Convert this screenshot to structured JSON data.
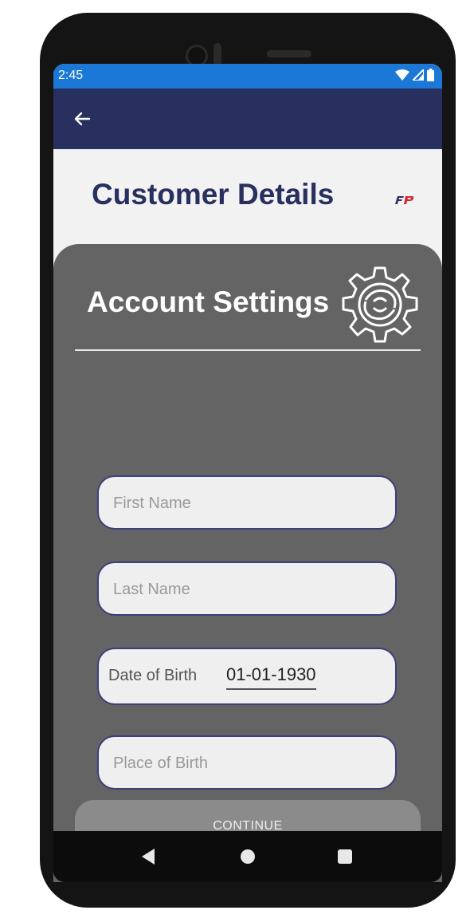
{
  "status_bar": {
    "time": "2:45",
    "icons": [
      "wifi-icon",
      "signal-icon",
      "battery-icon"
    ]
  },
  "app_bar": {
    "back_icon": "arrow-left-icon",
    "color": "#27305e"
  },
  "header": {
    "title": "Customer Details",
    "logo_text": "FP"
  },
  "panel": {
    "title": "Account Settings",
    "icon": "gear-icon",
    "fields": {
      "first_name_placeholder": "First Name",
      "last_name_placeholder": "Last Name",
      "dob_label": "Date of Birth",
      "dob_value": "01-01-1930",
      "place_of_birth_placeholder": "Place of Birth"
    },
    "continue_label": "CONTINUE"
  },
  "nav_bar": {
    "icons": [
      "nav-back-icon",
      "nav-home-icon",
      "nav-recents-icon"
    ]
  },
  "colors": {
    "status_bar": "#1b78d6",
    "primary": "#27305e",
    "panel": "#646464",
    "button": "#8b8b8b"
  }
}
